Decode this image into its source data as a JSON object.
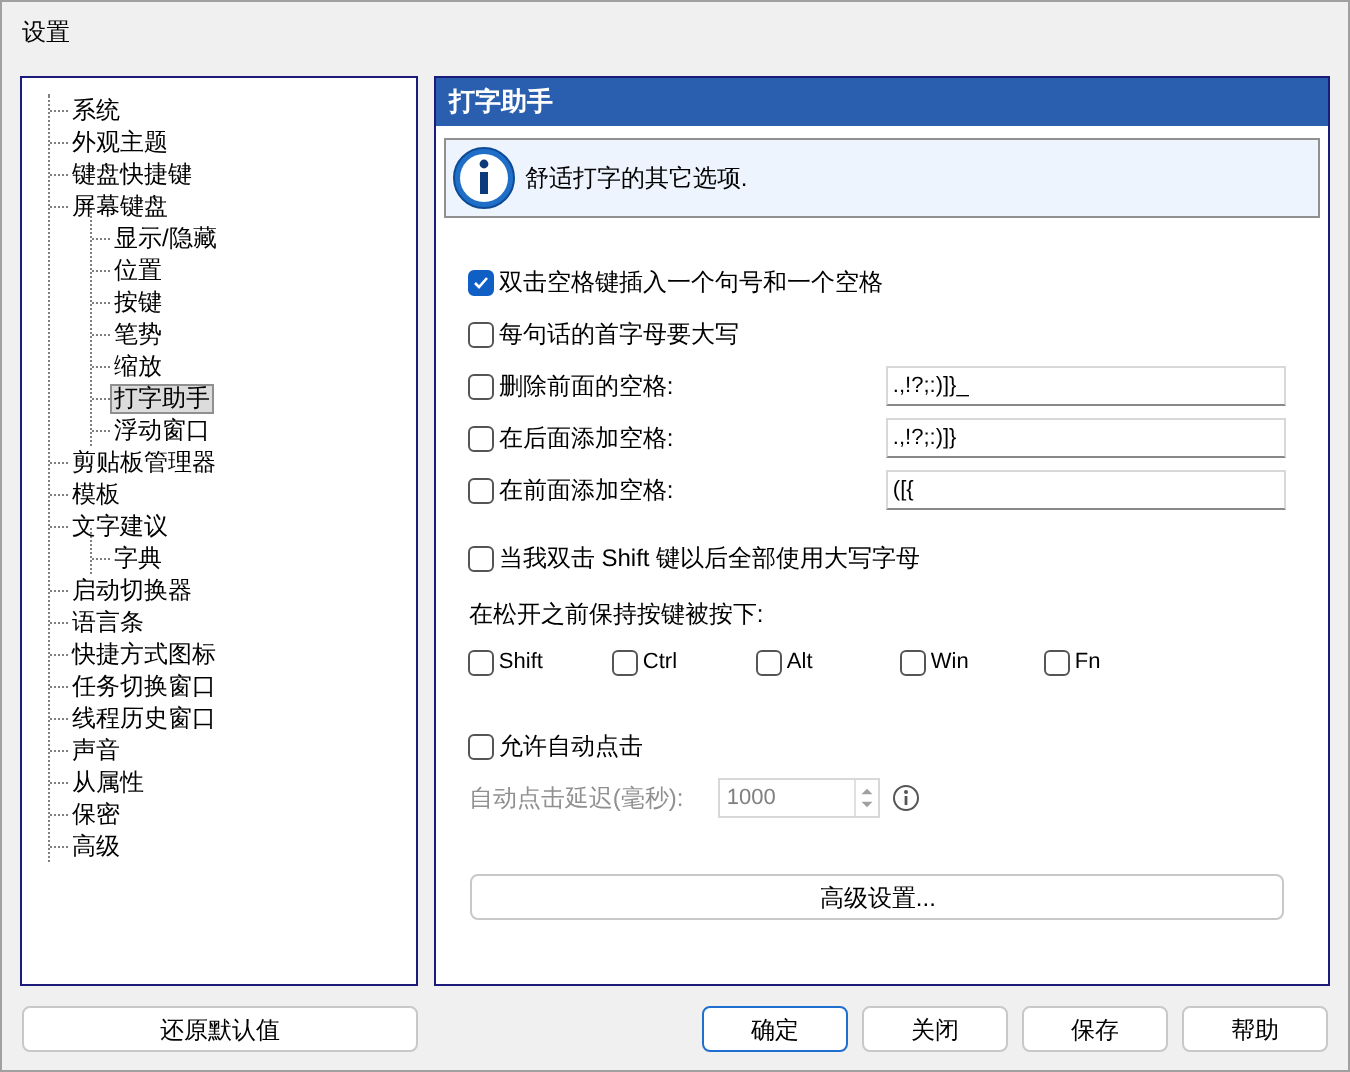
{
  "window": {
    "title": "设置"
  },
  "tree": [
    {
      "label": "系统",
      "selected": false
    },
    {
      "label": "外观主题",
      "selected": false
    },
    {
      "label": "键盘快捷键",
      "selected": false
    },
    {
      "label": "屏幕键盘",
      "selected": false,
      "children": [
        {
          "label": "显示/隐藏",
          "selected": false
        },
        {
          "label": "位置",
          "selected": false
        },
        {
          "label": "按键",
          "selected": false
        },
        {
          "label": "笔势",
          "selected": false
        },
        {
          "label": "缩放",
          "selected": false
        },
        {
          "label": "打字助手",
          "selected": true
        },
        {
          "label": "浮动窗口",
          "selected": false
        }
      ]
    },
    {
      "label": "剪贴板管理器",
      "selected": false
    },
    {
      "label": "模板",
      "selected": false
    },
    {
      "label": "文字建议",
      "selected": false,
      "children": [
        {
          "label": "字典",
          "selected": false
        }
      ]
    },
    {
      "label": "启动切换器",
      "selected": false
    },
    {
      "label": "语言条",
      "selected": false
    },
    {
      "label": "快捷方式图标",
      "selected": false
    },
    {
      "label": "任务切换窗口",
      "selected": false
    },
    {
      "label": "线程历史窗口",
      "selected": false
    },
    {
      "label": "声音",
      "selected": false
    },
    {
      "label": "从属性",
      "selected": false
    },
    {
      "label": "保密",
      "selected": false
    },
    {
      "label": "高级",
      "selected": false
    }
  ],
  "panel": {
    "title": "打字助手",
    "info": "舒适打字的其它选项.",
    "options": [
      {
        "kind": "checkbox",
        "label": "双击空格键插入一个句号和一个空格",
        "checked": true
      },
      {
        "kind": "checkbox",
        "label": "每句话的首字母要大写",
        "checked": false
      },
      {
        "kind": "field",
        "label": "删除前面的空格:",
        "checked": false,
        "value": ".,!?;:)]}_"
      },
      {
        "kind": "field",
        "label": "在后面添加空格:",
        "checked": false,
        "value": ".,!?;:)]}"
      },
      {
        "kind": "field",
        "label": "在前面添加空格:",
        "checked": false,
        "value": "([{"
      }
    ],
    "shift_caps": {
      "label": "当我双击 Shift 键以后全部使用大写字母",
      "checked": false
    },
    "hold_keys": {
      "label": "在松开之前保持按键被按下:",
      "keys": [
        {
          "label": "Shift",
          "checked": false
        },
        {
          "label": "Ctrl",
          "checked": false
        },
        {
          "label": "Alt",
          "checked": false
        },
        {
          "label": "Win",
          "checked": false
        },
        {
          "label": "Fn",
          "checked": false
        }
      ]
    },
    "auto_click": {
      "label": "允许自动点击",
      "checked": false
    },
    "click_delay": {
      "label": "自动点击延迟(毫秒):",
      "value": "1000",
      "disabled": true
    },
    "advanced_button": "高级设置..."
  },
  "reset_button": "还原默认值",
  "buttons": [
    {
      "label": "确定",
      "default": true
    },
    {
      "label": "关闭",
      "default": false
    },
    {
      "label": "保存",
      "default": false
    },
    {
      "label": "帮助",
      "default": false
    }
  ]
}
